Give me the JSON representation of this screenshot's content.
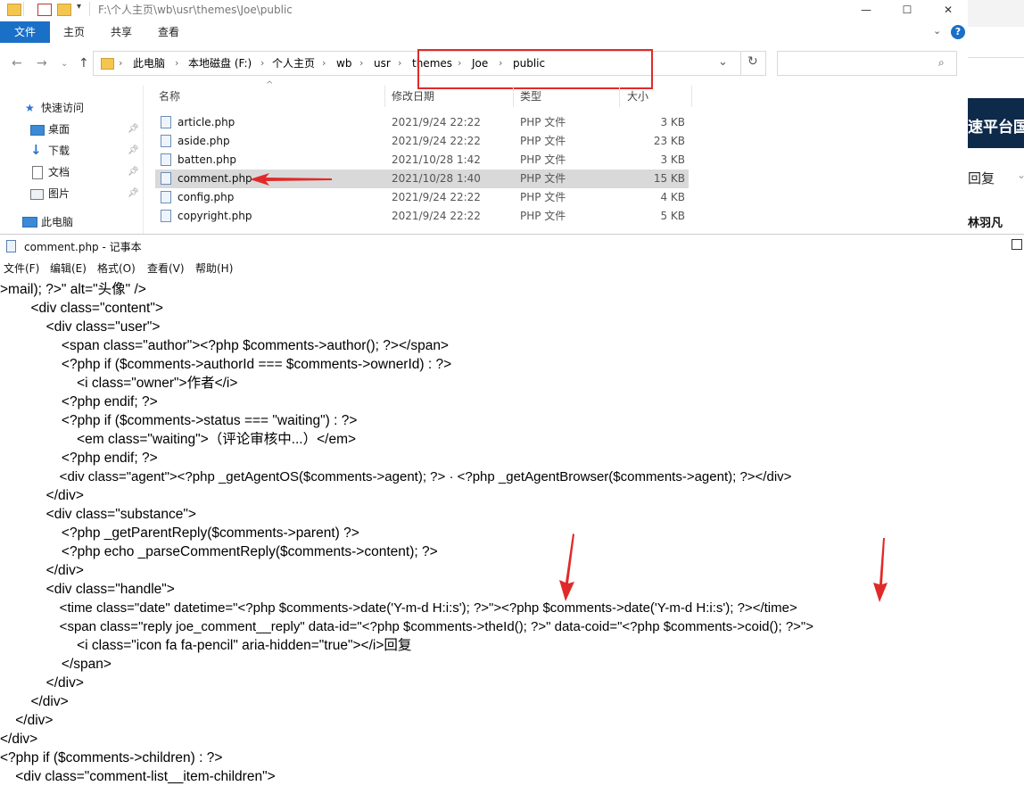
{
  "explorer": {
    "title_path": "F:\\个人主页\\wb\\usr\\themes\\Joe\\public",
    "window_controls": {
      "minimize": "—",
      "maximize": "☐",
      "close": "✕"
    },
    "ribbon_tabs": [
      "文件",
      "主页",
      "共享",
      "查看"
    ],
    "breadcrumbs": [
      "此电脑",
      "本地磁盘 (F:)",
      "个人主页",
      "wb",
      "usr",
      "themes",
      "Joe",
      "public"
    ],
    "search_placeholder": "",
    "nav": [
      {
        "label": "快速访问",
        "icon": "star-icon"
      },
      {
        "label": "桌面",
        "icon": "desktop-icon",
        "pinned": true
      },
      {
        "label": "下载",
        "icon": "download-icon",
        "pinned": true
      },
      {
        "label": "文档",
        "icon": "document-icon",
        "pinned": true
      },
      {
        "label": "图片",
        "icon": "picture-icon",
        "pinned": true
      },
      {
        "label": "此电脑",
        "icon": "computer-icon"
      }
    ],
    "columns": {
      "name": "名称",
      "date": "修改日期",
      "type": "类型",
      "size": "大小"
    },
    "files": [
      {
        "name": "article.php",
        "date": "2021/9/24 22:22",
        "type": "PHP 文件",
        "size": "3 KB"
      },
      {
        "name": "aside.php",
        "date": "2021/9/24 22:22",
        "type": "PHP 文件",
        "size": "23 KB"
      },
      {
        "name": "batten.php",
        "date": "2021/10/28 1:42",
        "type": "PHP 文件",
        "size": "3 KB"
      },
      {
        "name": "comment.php",
        "date": "2021/10/28 1:40",
        "type": "PHP 文件",
        "size": "15 KB",
        "selected": true
      },
      {
        "name": "config.php",
        "date": "2021/9/24 22:22",
        "type": "PHP 文件",
        "size": "4 KB"
      },
      {
        "name": "copyright.php",
        "date": "2021/9/24 22:22",
        "type": "PHP 文件",
        "size": "5 KB"
      }
    ]
  },
  "background_window": {
    "banner": "速平台国",
    "reply": "回复",
    "name": "林羽凡"
  },
  "notepad": {
    "title": "comment.php - 记事本",
    "menu": [
      "文件(F)",
      "编辑(E)",
      "格式(O)",
      "查看(V)",
      "帮助(H)"
    ],
    "lines": [
      ">mail); ?>\" alt=\"头像\" />",
      "        <div class=\"content\">",
      "            <div class=\"user\">",
      "                <span class=\"author\"><?php $comments->author(); ?></span>",
      "                <?php if ($comments->authorId === $comments->ownerId) : ?>",
      "                    <i class=\"owner\">作者</i>",
      "                <?php endif; ?>",
      "                <?php if ($comments->status === \"waiting\") : ?>",
      "                    <em class=\"waiting\">（评论审核中...）</em>",
      "                <?php endif; ?>",
      "                <div class=\"agent\"><?php _getAgentOS($comments->agent); ?> · <?php _getAgentBrowser($comments->agent); ?></div>",
      "            </div>",
      "            <div class=\"substance\">",
      "                <?php _getParentReply($comments->parent) ?>",
      "                <?php echo _parseCommentReply($comments->content); ?>",
      "            </div>",
      "            <div class=\"handle\">",
      "                <time class=\"date\" datetime=\"<?php $comments->date('Y-m-d H:i:s'); ?>\"><?php $comments->date('Y-m-d H:i:s'); ?></time>",
      "                <span class=\"reply joe_comment__reply\" data-id=\"<?php $comments->theId(); ?>\" data-coid=\"<?php $comments->coid(); ?>\">",
      "                    <i class=\"icon fa fa-pencil\" aria-hidden=\"true\"></i>回复",
      "                </span>",
      "            </div>",
      "        </div>",
      "    </div>",
      "</div>",
      "<?php if ($comments->children) : ?>",
      "    <div class=\"comment-list__item-children\">"
    ]
  },
  "colors": {
    "accent": "#1a6fc7",
    "highlight": "#e02a2a",
    "selected_row": "#d9d9d9"
  }
}
